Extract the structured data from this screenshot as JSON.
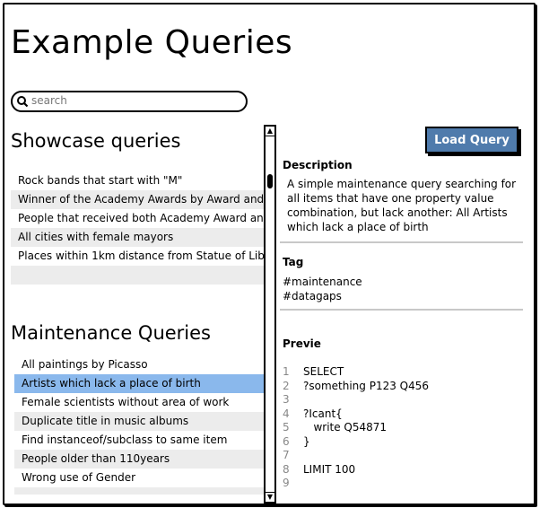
{
  "page": {
    "title": "Example Queries"
  },
  "search": {
    "placeholder": "search",
    "value": "",
    "icon": "search-icon"
  },
  "showcase": {
    "heading": "Showcase queries",
    "items": [
      {
        "label": "Rock bands that start with \"M\""
      },
      {
        "label": "Winner of the Academy Awards by Award and"
      },
      {
        "label": "People that received both Academy Award an"
      },
      {
        "label": "All cities with female mayors"
      },
      {
        "label": "Places within 1km distance from Statue of Lib"
      },
      {
        "label": ""
      }
    ]
  },
  "maintenance": {
    "heading": "Maintenance Queries",
    "selected_index": 1,
    "items": [
      {
        "label": "All paintings by Picasso"
      },
      {
        "label": "Artists which lack a place of birth"
      },
      {
        "label": "Female scientists without area of work"
      },
      {
        "label": "Duplicate title in music albums"
      },
      {
        "label": "Find instanceof/subclass to same item"
      },
      {
        "label": "People older than 110years"
      },
      {
        "label": "Wrong use of Gender"
      },
      {
        "label": ""
      }
    ]
  },
  "scrollbar": {
    "up_glyph": "▲",
    "down_glyph": "▼"
  },
  "detail": {
    "load_button_label": "Load Query",
    "description_label": "Description",
    "description_text": "A simple maintenance query searching for all items that have one property value combination, but lack another: All Artists which lack a place of birth",
    "tag_label": "Tag",
    "tags": [
      "#maintenance",
      "#datagaps"
    ],
    "preview_label": "Previe",
    "code_lines": [
      {
        "n": "1",
        "text": "SELECT"
      },
      {
        "n": "2",
        "text": "?something P123 Q456"
      },
      {
        "n": "3",
        "text": ""
      },
      {
        "n": "4",
        "text": "?Icant{"
      },
      {
        "n": "5",
        "text": "   write Q54871"
      },
      {
        "n": "6",
        "text": "}"
      },
      {
        "n": "7",
        "text": ""
      },
      {
        "n": "8",
        "text": "LIMIT 100"
      },
      {
        "n": "9",
        "text": ""
      }
    ]
  },
  "colors": {
    "accent_button": "#4f7bac",
    "selected_row": "#8ab8ec",
    "alt_row": "#ececec"
  }
}
